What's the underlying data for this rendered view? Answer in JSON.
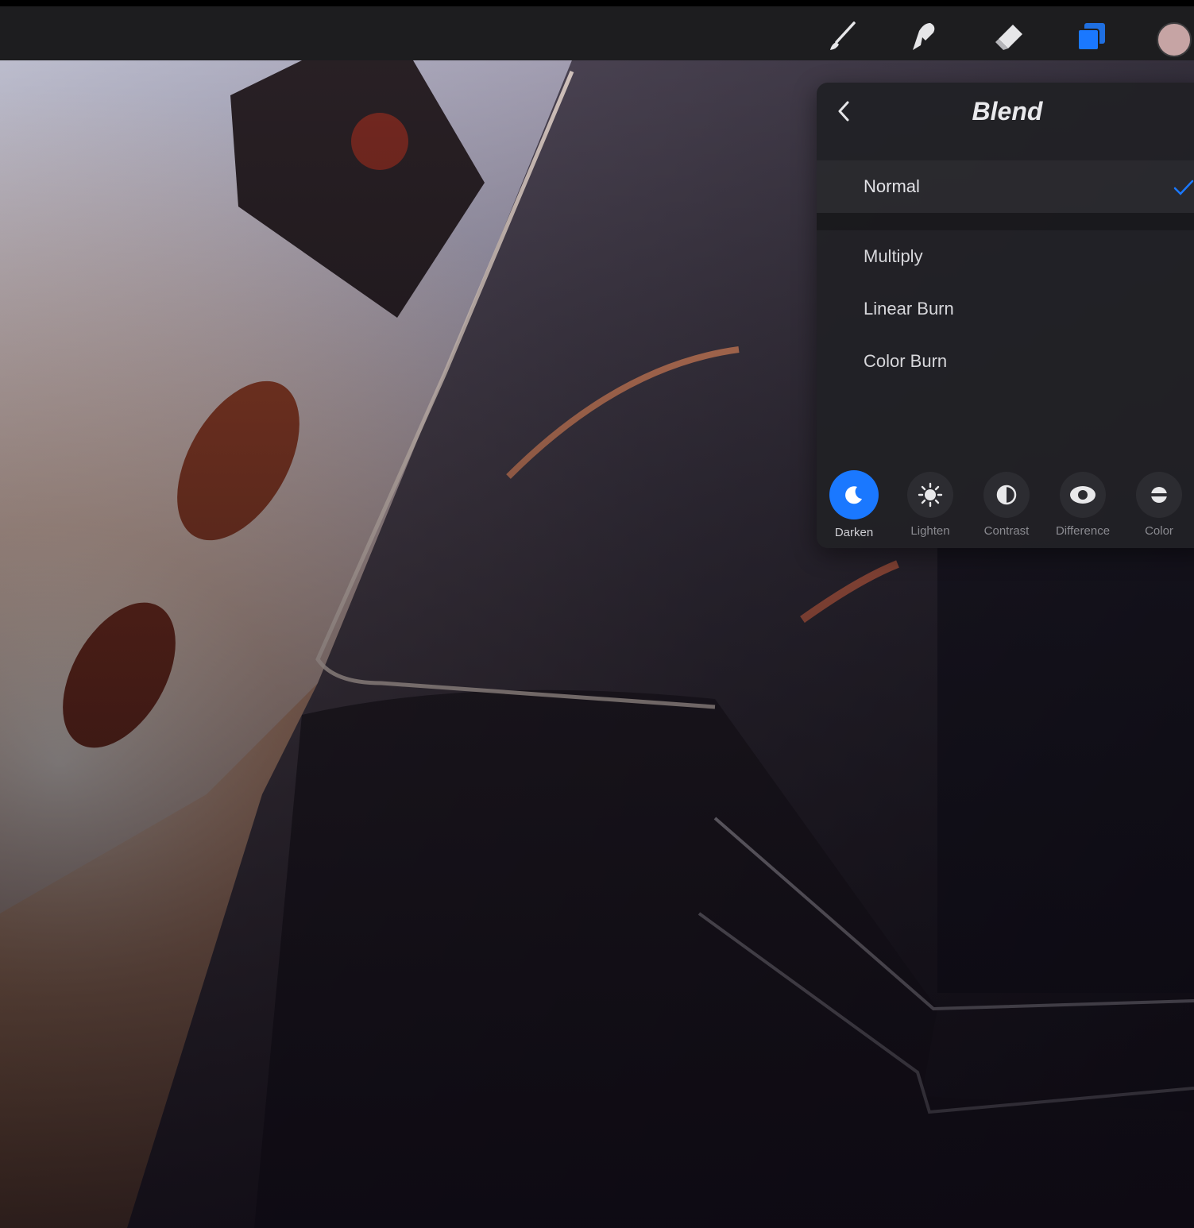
{
  "toolbar": {
    "tools": [
      "brush-icon",
      "smudge-icon",
      "eraser-icon",
      "layers-icon"
    ],
    "active_tool": "layers",
    "color_swatch": "#c6a4a4",
    "accent": "#1a78ff"
  },
  "blend_panel": {
    "title": "Blend",
    "modes": [
      {
        "label": "Normal",
        "selected": true
      },
      {
        "label": "Multiply",
        "selected": false
      },
      {
        "label": "Linear Burn",
        "selected": false
      },
      {
        "label": "Color Burn",
        "selected": false
      }
    ],
    "categories": [
      {
        "label": "Darken",
        "icon": "moon-icon",
        "active": true
      },
      {
        "label": "Lighten",
        "icon": "sun-icon",
        "active": false
      },
      {
        "label": "Contrast",
        "icon": "contrast-icon",
        "active": false
      },
      {
        "label": "Difference",
        "icon": "difference-icon",
        "active": false
      },
      {
        "label": "Color",
        "icon": "color-icon",
        "active": false
      }
    ]
  }
}
